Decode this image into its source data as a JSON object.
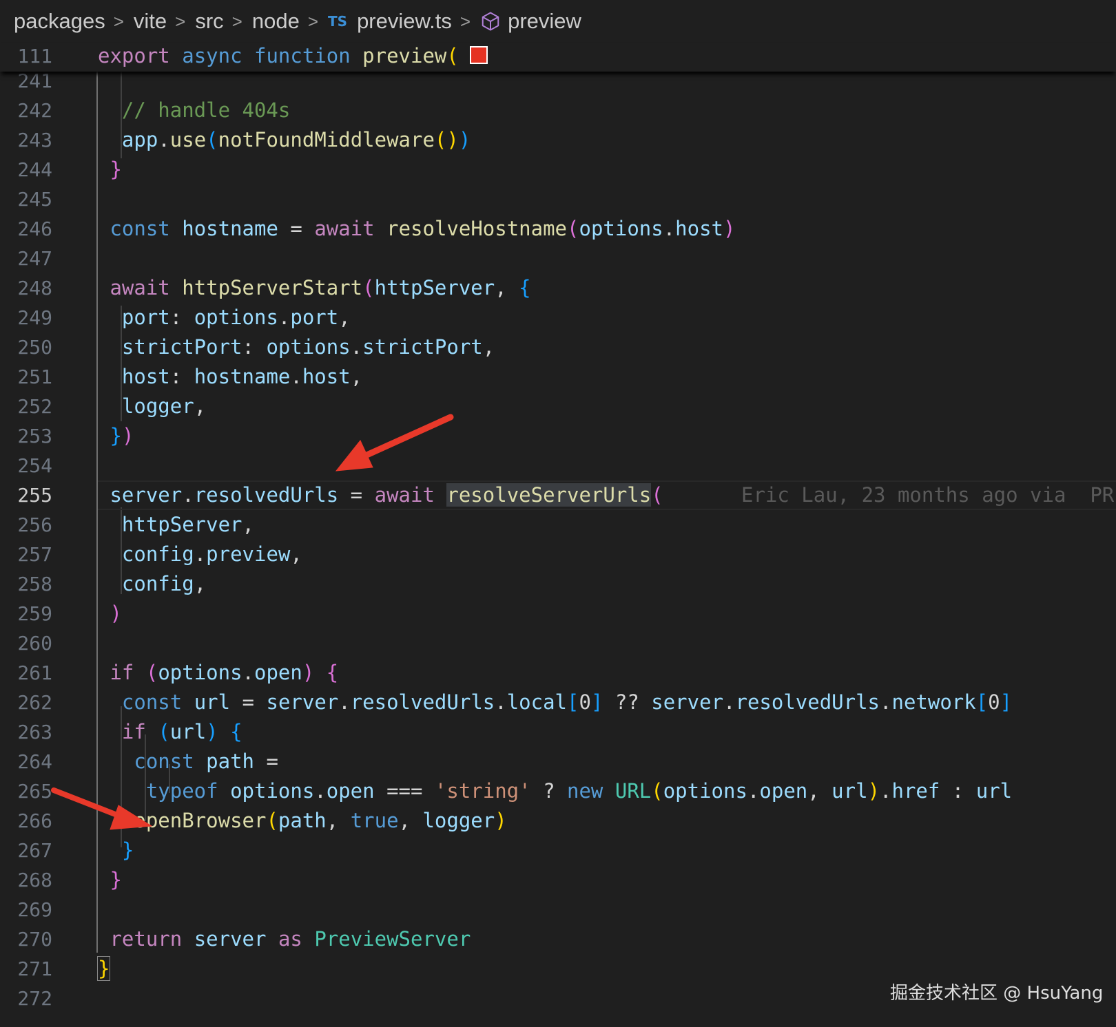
{
  "breadcrumb": {
    "items": [
      "packages",
      "vite",
      "src",
      "node"
    ],
    "file_badge": "TS",
    "file": "preview.ts",
    "symbol": "preview"
  },
  "sticky_line": {
    "number": "111",
    "kw1": "export",
    "kw2": "async",
    "kw3": "function",
    "name": "preview",
    "paren": "("
  },
  "lines": {
    "l241": "241",
    "l242": "242",
    "l243": "243",
    "l244": "244",
    "l245": "245",
    "l246": "246",
    "l247": "247",
    "l248": "248",
    "l249": "249",
    "l250": "250",
    "l251": "251",
    "l252": "252",
    "l253": "253",
    "l254": "254",
    "l255": "255",
    "l256": "256",
    "l257": "257",
    "l258": "258",
    "l259": "259",
    "l260": "260",
    "l261": "261",
    "l262": "262",
    "l263": "263",
    "l264": "264",
    "l265": "265",
    "l266": "266",
    "l267": "267",
    "l268": "268",
    "l269": "269",
    "l270": "270",
    "l271": "271",
    "l272": "272"
  },
  "blame": "Eric Lau, 23 months ago via  PR",
  "watermark": "掘金技术社区 @ HsuYang",
  "colors": {
    "background": "#1f1f1f",
    "arrow": "#e8392a",
    "keyword": "#c586c0",
    "storage": "#569cd6",
    "function": "#dcdcaa",
    "variable": "#9cdcfe",
    "comment": "#6a9955",
    "string": "#ce9178",
    "type": "#4ec9b0"
  },
  "icons": [
    "chevron-right-icon",
    "typescript-icon",
    "symbol-method-icon",
    "arrow-annotation"
  ]
}
